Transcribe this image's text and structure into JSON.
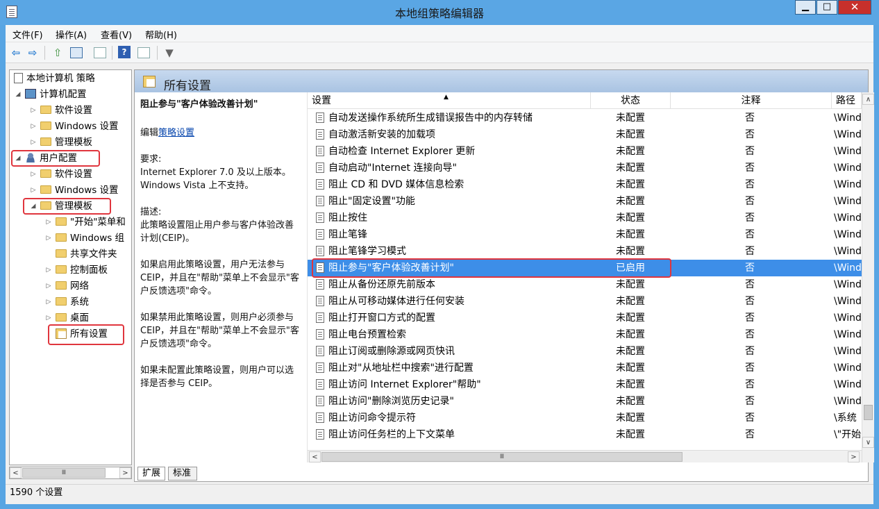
{
  "window": {
    "title": "本地组策略编辑器",
    "min_label": "▁",
    "max_label": "□",
    "close_label": "✕"
  },
  "menu": [
    "文件(F)",
    "操作(A)",
    "查看(V)",
    "帮助(H)"
  ],
  "tree": {
    "root": "本地计算机 策略",
    "computer": "计算机配置",
    "c_software": "软件设置",
    "c_windows": "Windows 设置",
    "c_admin": "管理模板",
    "user": "用户配置",
    "u_software": "软件设置",
    "u_windows": "Windows 设置",
    "u_admin": "管理模板",
    "a_start": "\"开始\"菜单和",
    "a_wincomp": "Windows 组",
    "a_shared": "共享文件夹",
    "a_control": "控制面板",
    "a_network": "网络",
    "a_system": "系统",
    "a_desktop": "桌面",
    "a_all": "所有设置"
  },
  "pane": {
    "title": "所有设置"
  },
  "desc": {
    "policy_name": "阻止参与\"客户体验改善计划\"",
    "edit_prefix": "编辑",
    "edit_link": "策略设置",
    "req_label": "要求:",
    "req_text": "Internet Explorer 7.0 及以上版本。Windows Vista 上不支持。",
    "desc_label": "描述:",
    "desc_text": "此策略设置阻止用户参与客户体验改善计划(CEIP)。",
    "p_enabled": "如果启用此策略设置，用户无法参与 CEIP，并且在\"帮助\"菜单上不会显示\"客户反馈选项\"命令。",
    "p_disabled": "如果禁用此策略设置，则用户必须参与 CEIP，并且在\"帮助\"菜单上不会显示\"客户反馈选项\"命令。",
    "p_notconf": "如果未配置此策略设置，则用户可以选择是否参与 CEIP。"
  },
  "columns": {
    "setting": "设置",
    "state": "状态",
    "comment": "注释",
    "path": "路径"
  },
  "rows": [
    {
      "name": "自动发送操作系统所生成错误报告中的内存转储",
      "state": "未配置",
      "comment": "否",
      "path": "\\Windows 组件"
    },
    {
      "name": "自动激活新安装的加载项",
      "state": "未配置",
      "comment": "否",
      "path": "\\Windows 组件"
    },
    {
      "name": "自动检查 Internet Explorer 更新",
      "state": "未配置",
      "comment": "否",
      "path": "\\Windows 组件"
    },
    {
      "name": "自动启动\"Internet 连接向导\"",
      "state": "未配置",
      "comment": "否",
      "path": "\\Windows 组件"
    },
    {
      "name": "阻止 CD 和 DVD 媒体信息检索",
      "state": "未配置",
      "comment": "否",
      "path": "\\Windows 组件"
    },
    {
      "name": "阻止\"固定设置\"功能",
      "state": "未配置",
      "comment": "否",
      "path": "\\Windows 组件"
    },
    {
      "name": "阻止按住",
      "state": "未配置",
      "comment": "否",
      "path": "\\Windows 组件"
    },
    {
      "name": "阻止笔锋",
      "state": "未配置",
      "comment": "否",
      "path": "\\Windows 组件"
    },
    {
      "name": "阻止笔锋学习模式",
      "state": "未配置",
      "comment": "否",
      "path": "\\Windows 组件"
    },
    {
      "name": "阻止参与\"客户体验改善计划\"",
      "state": "已启用",
      "comment": "否",
      "path": "\\Windows 组件"
    },
    {
      "name": "阻止从备份还原先前版本",
      "state": "未配置",
      "comment": "否",
      "path": "\\Windows 组件"
    },
    {
      "name": "阻止从可移动媒体进行任何安装",
      "state": "未配置",
      "comment": "否",
      "path": "\\Windows 组件"
    },
    {
      "name": "阻止打开窗口方式的配置",
      "state": "未配置",
      "comment": "否",
      "path": "\\Windows 组件"
    },
    {
      "name": "阻止电台预置检索",
      "state": "未配置",
      "comment": "否",
      "path": "\\Windows 组件"
    },
    {
      "name": "阻止订阅或删除源或网页快讯",
      "state": "未配置",
      "comment": "否",
      "path": "\\Windows 组件"
    },
    {
      "name": "阻止对\"从地址栏中搜索\"进行配置",
      "state": "未配置",
      "comment": "否",
      "path": "\\Windows 组件"
    },
    {
      "name": "阻止访问 Internet Explorer\"帮助\"",
      "state": "未配置",
      "comment": "否",
      "path": "\\Windows 组件"
    },
    {
      "name": "阻止访问\"删除浏览历史记录\"",
      "state": "未配置",
      "comment": "否",
      "path": "\\Windows 组件"
    },
    {
      "name": "阻止访问命令提示符",
      "state": "未配置",
      "comment": "否",
      "path": "\\系统"
    },
    {
      "name": "阻止访问任务栏的上下文菜单",
      "state": "未配置",
      "comment": "否",
      "path": "\\\"开始\"菜单和任务栏"
    }
  ],
  "tabs": [
    "扩展",
    "标准"
  ],
  "status": "1590 个设置",
  "scroll": {
    "thumb_glyph": "Ⅲ"
  },
  "colors": {
    "selection": "#3d8ee8",
    "highlight_box": "#e0353d",
    "titlebar": "#5aa6e4"
  }
}
